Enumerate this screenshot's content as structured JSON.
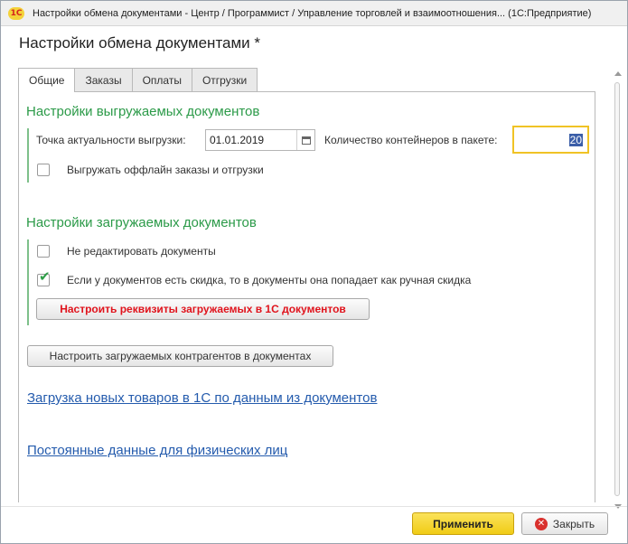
{
  "window": {
    "logo": "1С",
    "title": "Настройки обмена документами - Центр / Программист / Управление торговлей и взаимоотношения... (1С:Предприятие)"
  },
  "form": {
    "title": "Настройки обмена документами *"
  },
  "tabs": [
    {
      "label": "Общие",
      "active": true
    },
    {
      "label": "Заказы",
      "active": false
    },
    {
      "label": "Оплаты",
      "active": false
    },
    {
      "label": "Отгрузки",
      "active": false
    }
  ],
  "export_section": {
    "title": "Настройки выгружаемых документов",
    "date_label": "Точка актуальности выгрузки:",
    "date_value": "01.01.2019",
    "containers_label": "Количество контейнеров в пакете:",
    "containers_value": "20",
    "offline_checkbox": {
      "label": "Выгружать оффлайн заказы и отгрузки",
      "checked": false
    }
  },
  "import_section": {
    "title": "Настройки загружаемых документов",
    "no_edit_checkbox": {
      "label": "Не редактировать документы",
      "checked": false
    },
    "discount_checkbox": {
      "label": "Если у документов есть скидка, то в документы она попадает как ручная скидка",
      "checked": true
    },
    "requisites_button": "Настроить реквизиты загружаемых в 1С документов"
  },
  "counterparties_button": "Настроить загружаемых контрагентов в документах",
  "links": {
    "new_goods": "Загрузка новых товаров в 1С по данным из документов",
    "individuals": "Постоянные данные для физических лиц"
  },
  "footer": {
    "apply_button": "Применить",
    "close_button": "Закрыть"
  },
  "colors": {
    "section_green": "#2b9a48",
    "link_blue": "#245bad",
    "apply_yellow": "#f0cc15",
    "warning_red": "#e0131c"
  }
}
